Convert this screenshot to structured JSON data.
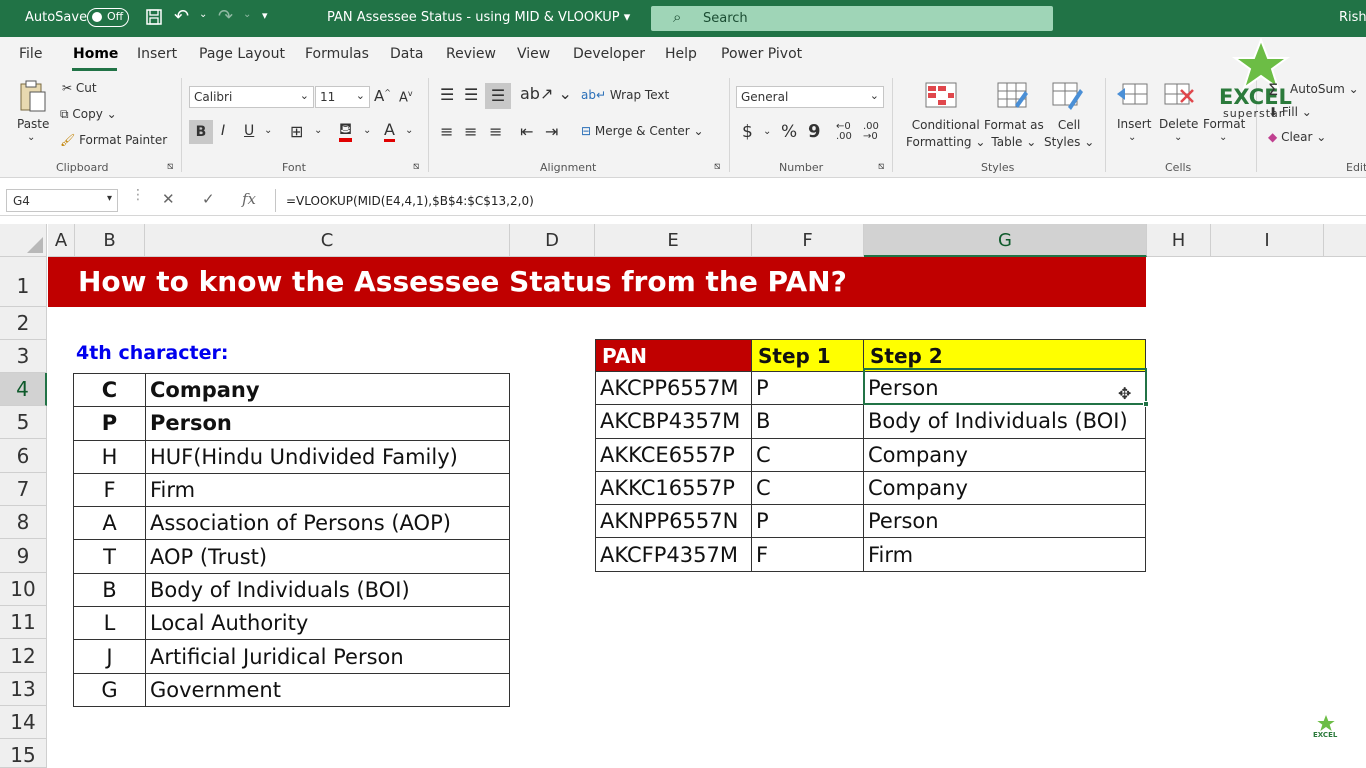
{
  "titlebar": {
    "autosave_label": "AutoSave",
    "autosave_state": "Off",
    "doc_title": "PAN Assessee Status - using MID & VLOOKUP",
    "search_placeholder": "Search",
    "user": "Rish"
  },
  "menu": {
    "items": [
      "File",
      "Home",
      "Insert",
      "Page Layout",
      "Formulas",
      "Data",
      "Review",
      "View",
      "Developer",
      "Help",
      "Power Pivot"
    ],
    "active": "Home"
  },
  "ribbon": {
    "clipboard": {
      "paste": "Paste",
      "cut": "Cut",
      "copy": "Copy",
      "format_painter": "Format Painter",
      "label": "Clipboard"
    },
    "font": {
      "name": "Calibri",
      "size": "11",
      "bold": "B",
      "italic": "I",
      "underline": "U",
      "font_color_icon": "A",
      "label": "Font"
    },
    "alignment": {
      "wrap_text": "Wrap Text",
      "merge_center": "Merge & Center",
      "label": "Alignment"
    },
    "number": {
      "format": "General",
      "currency": "$",
      "percent": "%",
      "comma": "9",
      "label": "Number"
    },
    "styles": {
      "conditional": "Conditional",
      "conditional2": "Formatting",
      "format_as": "Format as",
      "format_as2": "Table",
      "cell": "Cell",
      "cell2": "Styles",
      "label": "Styles"
    },
    "cells": {
      "insert": "Insert",
      "delete": "Delete",
      "format": "Format",
      "label": "Cells"
    },
    "editing": {
      "autosum": "AutoSum",
      "fill": "Fill",
      "clear": "Clear",
      "label": "Edit"
    },
    "logo_text": "EXCEL",
    "logo_sub": "superstar"
  },
  "formula_bar": {
    "name_box": "G4",
    "formula": "=VLOOKUP(MID(E4,4,1),$B$4:$C$13,2,0)",
    "fx": "fx"
  },
  "columns": [
    "A",
    "B",
    "C",
    "D",
    "E",
    "F",
    "G",
    "H",
    "I"
  ],
  "rows": [
    "1",
    "2",
    "3",
    "4",
    "5",
    "6",
    "7",
    "8",
    "9",
    "10",
    "11",
    "12",
    "13",
    "14",
    "15"
  ],
  "sheet": {
    "title": "How to know the Assessee Status from the PAN?",
    "label_4th": "4th character:",
    "status_table": [
      {
        "code": "C",
        "desc": "Company"
      },
      {
        "code": "P",
        "desc": "Person"
      },
      {
        "code": "H",
        "desc": "HUF(Hindu Undivided Family)"
      },
      {
        "code": "F",
        "desc": "Firm"
      },
      {
        "code": "A",
        "desc": "Association of Persons (AOP)"
      },
      {
        "code": "T",
        "desc": "AOP (Trust)"
      },
      {
        "code": "B",
        "desc": "Body of Individuals (BOI)"
      },
      {
        "code": "L",
        "desc": "Local Authority"
      },
      {
        "code": "J",
        "desc": "Artificial Juridical Person"
      },
      {
        "code": "G",
        "desc": "Government"
      }
    ],
    "pan_headers": {
      "pan": "PAN",
      "step1": "Step 1",
      "step2": "Step 2"
    },
    "pan_rows": [
      {
        "pan": "AKCPP6557M",
        "step1": "P",
        "step2": "Person"
      },
      {
        "pan": "AKCBP4357M",
        "step1": "B",
        "step2": "Body of Individuals (BOI)"
      },
      {
        "pan": "AKKCE6557P",
        "step1": "C",
        "step2": "Company"
      },
      {
        "pan": "AKKC16557P",
        "step1": "C",
        "step2": "Company"
      },
      {
        "pan": "AKNPP6557N",
        "step1": "P",
        "step2": "Person"
      },
      {
        "pan": "AKCFP4357M",
        "step1": "F",
        "step2": "Firm"
      }
    ]
  },
  "colors": {
    "excel_green": "#217346",
    "banner_red": "#c00000",
    "pan_header": "#c00000",
    "step_header": "#ffff00",
    "label_blue": "#0000ee"
  }
}
